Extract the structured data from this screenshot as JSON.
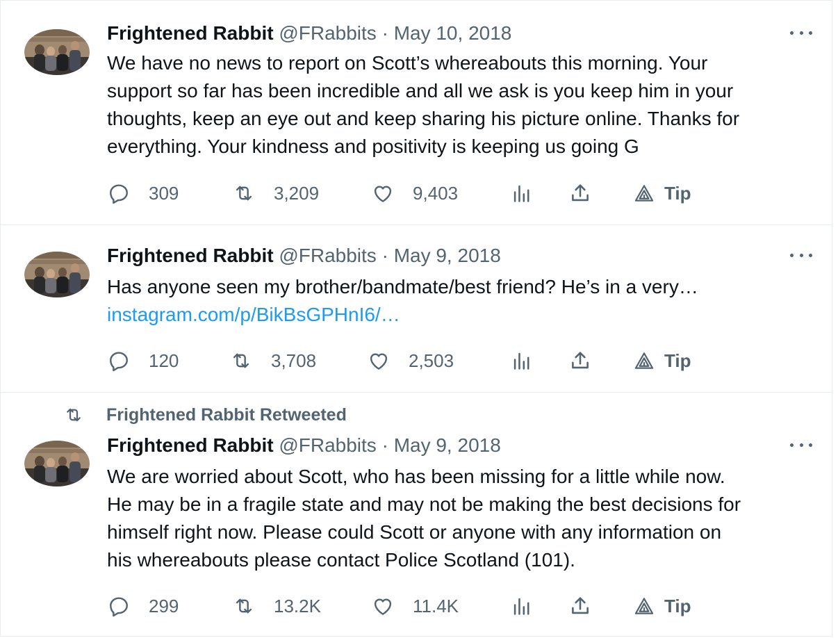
{
  "tweets": [
    {
      "name": "Frightened Rabbit",
      "handle": "@FRabbits",
      "sep": "·",
      "date": "May 10, 2018",
      "text": "We have no news to report on Scott’s whereabouts this morning. Your\nsupport so far has been incredible and all we ask is you keep him in your\nthoughts, keep an eye out and keep sharing his picture online. Thanks for\neverything. Your kindness and positivity is keeping us going G",
      "replies": "309",
      "retweets": "3,209",
      "likes": "9,403",
      "tip": "Tip"
    },
    {
      "name": "Frightened Rabbit",
      "handle": "@FRabbits",
      "sep": "·",
      "date": "May 9, 2018",
      "text": "Has anyone seen my brother/bandmate/best friend? He’s in a very…",
      "link": "instagram.com/p/BikBsGPHnI6/…",
      "replies": "120",
      "retweets": "3,708",
      "likes": "2,503",
      "tip": "Tip"
    },
    {
      "social_context": "Frightened Rabbit Retweeted",
      "name": "Frightened Rabbit",
      "handle": "@FRabbits",
      "sep": "·",
      "date": "May 9, 2018",
      "text": "We are worried about Scott, who has been missing for a little while now.\nHe may be in a fragile state and may not be making the best decisions for\nhimself right now. Please could Scott or anyone with any information on\nhis whereabouts please contact Police Scotland (101).",
      "replies": "299",
      "retweets": "13.2K",
      "likes": "11.4K",
      "tip": "Tip"
    }
  ],
  "icons": {
    "reply": "reply-icon",
    "retweet": "retweet-icon",
    "like": "heart-icon",
    "views": "analytics-icon",
    "share": "share-icon",
    "tip": "tip-icon",
    "more": "more-options-icon"
  },
  "colors": {
    "text": "#0f1419",
    "secondary": "#536471",
    "link": "#1d9bf0",
    "border": "#e6ecf0"
  }
}
